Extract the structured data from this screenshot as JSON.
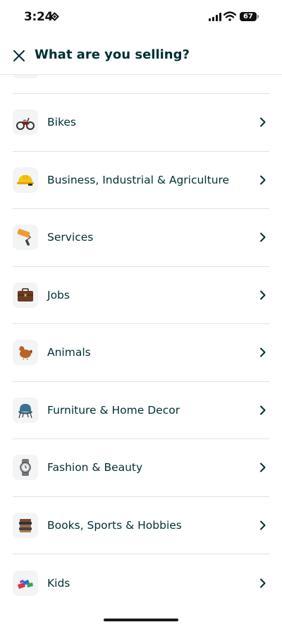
{
  "status_bar": {
    "time": "3:24",
    "battery": "67"
  },
  "header": {
    "title": "What are you selling?",
    "close_icon": "close-icon"
  },
  "categories": [
    {
      "label": "Bikes",
      "icon": "motorbike-icon",
      "chevron": "chevron-right-icon"
    },
    {
      "label": "Business, Industrial & Agriculture",
      "icon": "hard-hat-icon",
      "chevron": "chevron-right-icon"
    },
    {
      "label": "Services",
      "icon": "paint-roller-icon",
      "chevron": "chevron-right-icon"
    },
    {
      "label": "Jobs",
      "icon": "briefcase-icon",
      "chevron": "chevron-right-icon"
    },
    {
      "label": "Animals",
      "icon": "hen-icon",
      "chevron": "chevron-right-icon"
    },
    {
      "label": "Furniture & Home Decor",
      "icon": "armchair-icon",
      "chevron": "chevron-right-icon"
    },
    {
      "label": "Fashion & Beauty",
      "icon": "wristwatch-icon",
      "chevron": "chevron-right-icon"
    },
    {
      "label": "Books, Sports & Hobbies",
      "icon": "books-stack-icon",
      "chevron": "chevron-right-icon"
    },
    {
      "label": "Kids",
      "icon": "toy-blocks-icon",
      "chevron": "chevron-right-icon"
    }
  ],
  "colors": {
    "text": "#002f34",
    "divider": "#dfe3e3",
    "tile": "#f2f4f5"
  }
}
